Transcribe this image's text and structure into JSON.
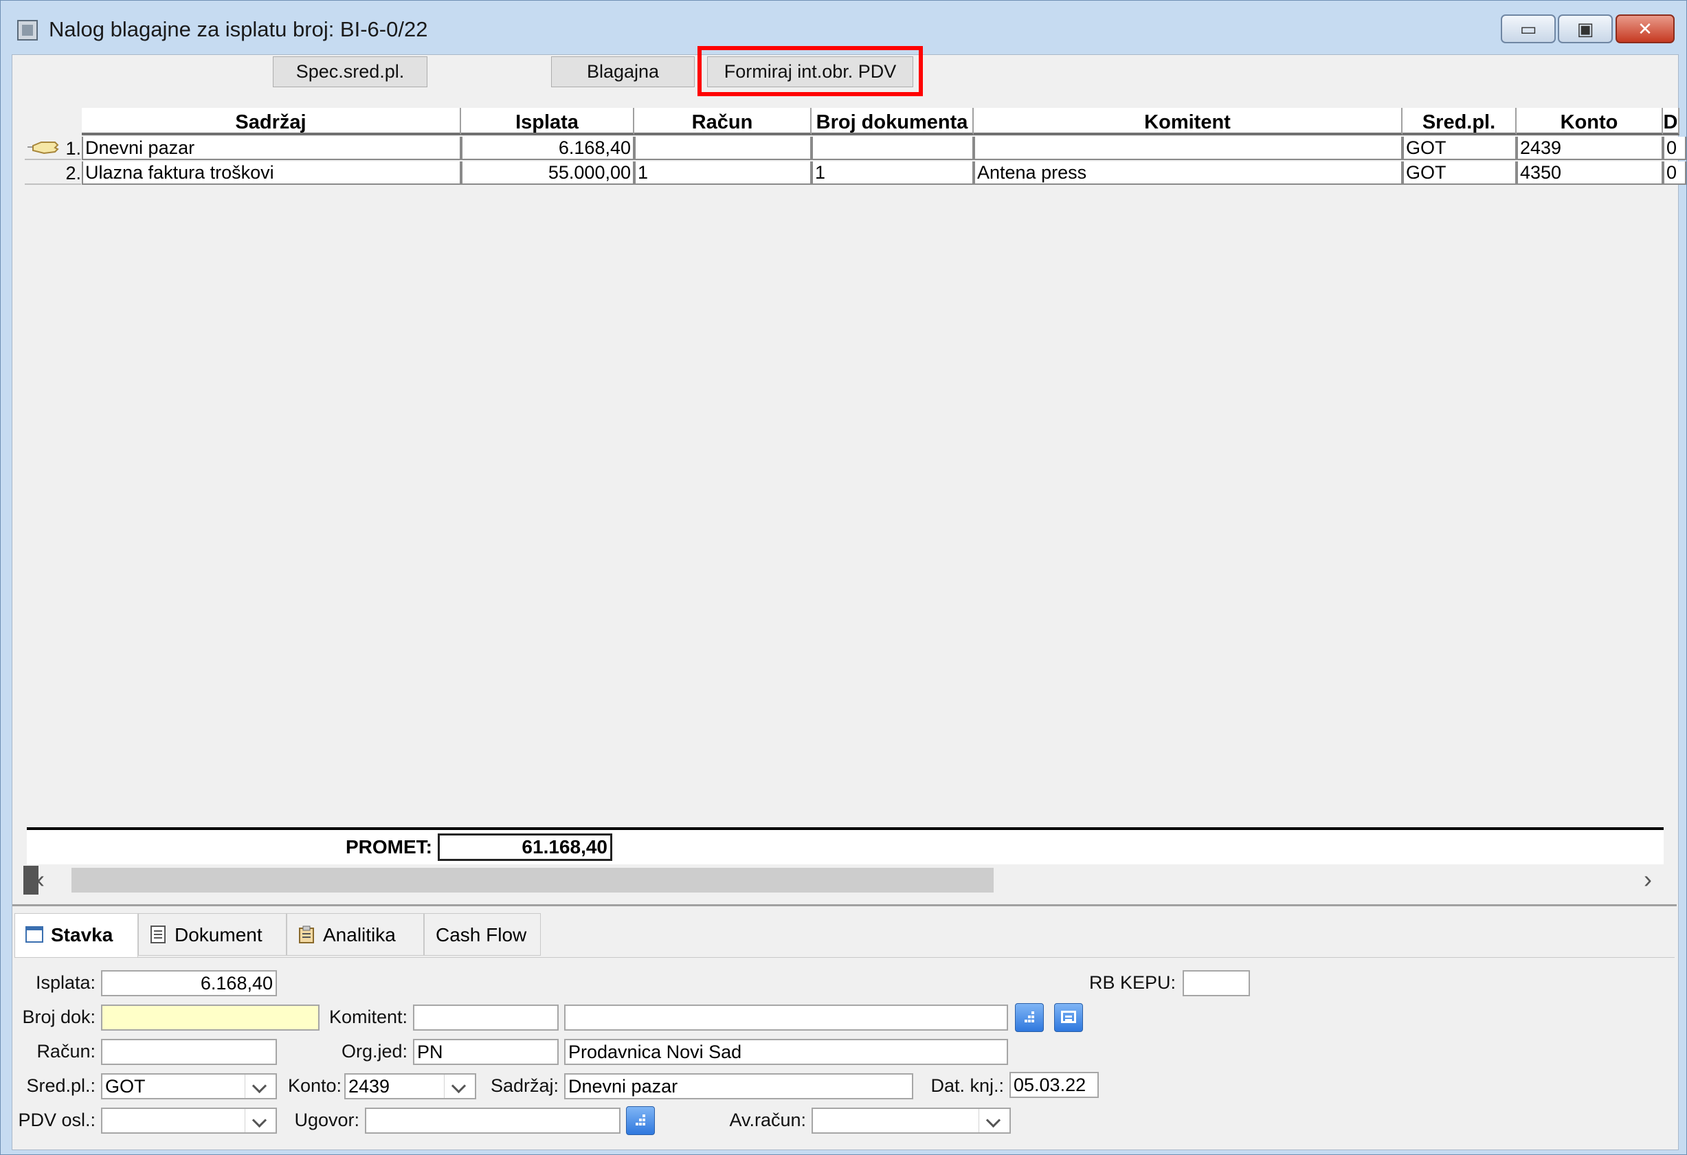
{
  "window": {
    "title": "Nalog blagajne za isplatu broj: BI-6-0/22",
    "min_glyph": "▭",
    "max_glyph": "▣",
    "close_glyph": "✕"
  },
  "toolbar": {
    "spec_label": "Spec.sred.pl.",
    "blagajna_label": "Blagajna",
    "formiraj_label": "Formiraj int.obr. PDV"
  },
  "table": {
    "columns": [
      "Sadržaj",
      "Isplata",
      "Račun",
      "Broj dokumenta",
      "Komitent",
      "Sred.pl.",
      "Konto",
      "D"
    ],
    "rows": [
      {
        "no": "1.",
        "sadrzaj": "Dnevni pazar",
        "isplata": "6.168,40",
        "racun": "",
        "broj_dok": "",
        "komitent": "",
        "sred": "GOT",
        "konto": "2439",
        "d": "0"
      },
      {
        "no": "2.",
        "sadrzaj": "Ulazna faktura troškovi",
        "isplata": "55.000,00",
        "racun": "1",
        "broj_dok": "1",
        "komitent": "Antena press",
        "sred": "GOT",
        "konto": "4350",
        "d": "0"
      }
    ],
    "total_label": "PROMET:",
    "total_value": "61.168,40"
  },
  "scroll": {
    "left": "‹",
    "right": "›"
  },
  "tabs": [
    "Stavka",
    "Dokument",
    "Analitika",
    "Cash Flow"
  ],
  "form": {
    "isplata_label": "Isplata:",
    "isplata_value": "6.168,40",
    "rbkepu_label": "RB KEPU:",
    "rbkepu_value": "",
    "brojdok_label": "Broj dok:",
    "brojdok_value": "",
    "komitent_label": "Komitent:",
    "komitent_code": "",
    "komitent_name": "",
    "racun_label": "Račun:",
    "racun_value": "",
    "orgjed_label": "Org.jed:",
    "orgjed_code": "PN",
    "orgjed_name": "Prodavnica Novi Sad",
    "sredpl_label": "Sred.pl.:",
    "sredpl_value": "GOT",
    "konto_label": "Konto:",
    "konto_value": "2439",
    "sadrzaj_label": "Sadržaj:",
    "sadrzaj_value": "Dnevni pazar",
    "datknj_label": "Dat. knj.:",
    "datknj_value": "05.03.22",
    "pdvosl_label": "PDV osl.:",
    "pdvosl_value": "",
    "ugovor_label": "Ugovor:",
    "ugovor_value": "",
    "avracun_label": "Av.račun:",
    "avracun_value": ""
  },
  "colors": {
    "highlight": "#ff0000",
    "yellow_field": "#ffffc8",
    "title_bg": "#c6dbf1"
  }
}
